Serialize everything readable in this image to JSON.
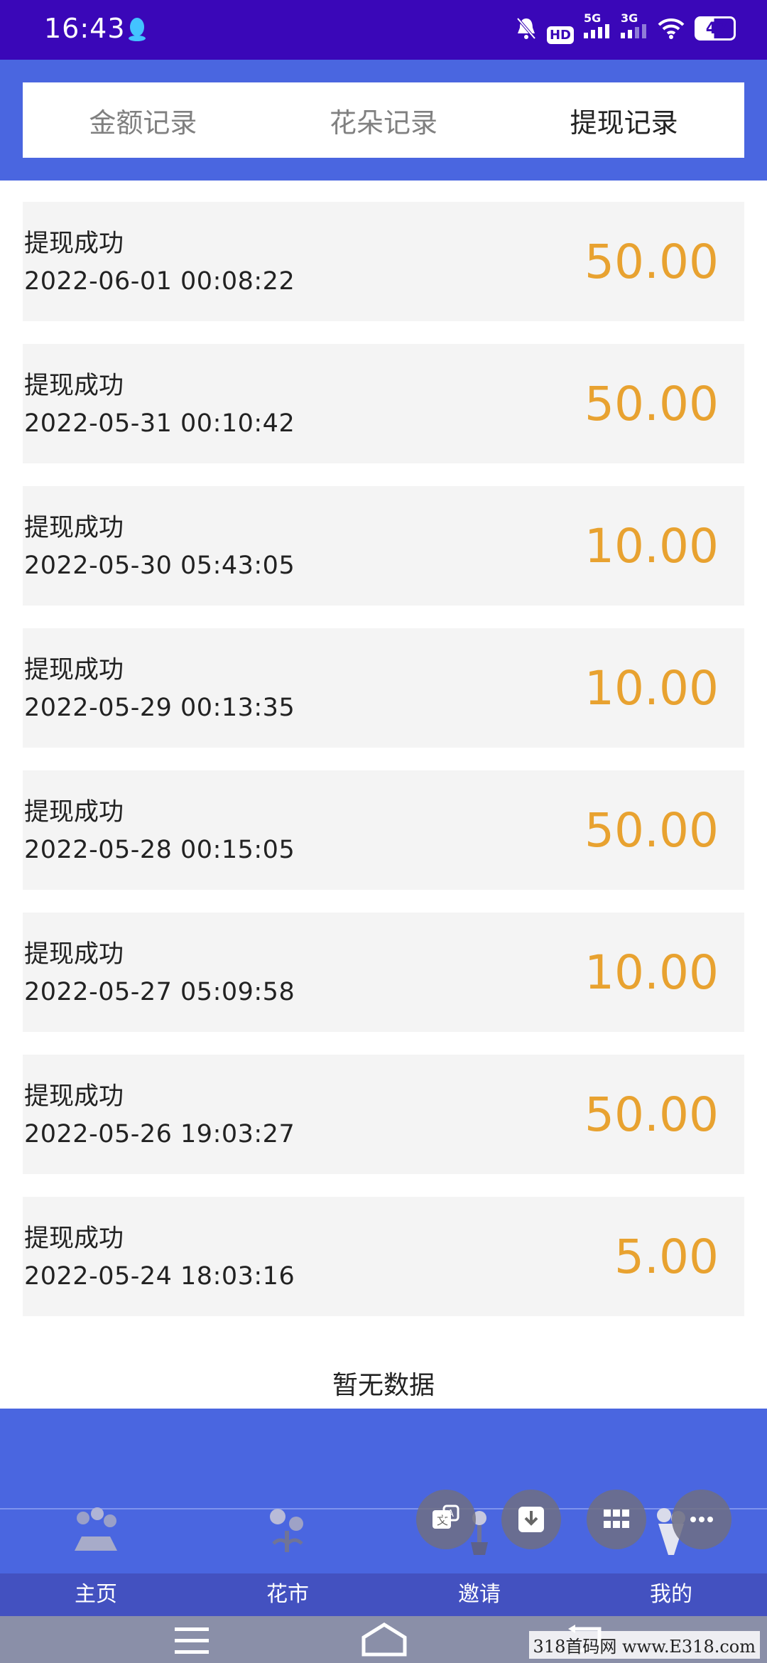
{
  "status_bar": {
    "time": "16:43",
    "network_1": "5G",
    "network_2": "3G",
    "hd": "HD",
    "battery": "47"
  },
  "tabs": [
    {
      "label": "金额记录",
      "active": false
    },
    {
      "label": "花朵记录",
      "active": false
    },
    {
      "label": "提现记录",
      "active": true
    }
  ],
  "records": [
    {
      "status": "提现成功",
      "datetime": "2022-06-01 00:08:22",
      "amount": "50.00"
    },
    {
      "status": "提现成功",
      "datetime": "2022-05-31 00:10:42",
      "amount": "50.00"
    },
    {
      "status": "提现成功",
      "datetime": "2022-05-30 05:43:05",
      "amount": "10.00"
    },
    {
      "status": "提现成功",
      "datetime": "2022-05-29 00:13:35",
      "amount": "10.00"
    },
    {
      "status": "提现成功",
      "datetime": "2022-05-28 00:15:05",
      "amount": "50.00"
    },
    {
      "status": "提现成功",
      "datetime": "2022-05-27 05:09:58",
      "amount": "10.00"
    },
    {
      "status": "提现成功",
      "datetime": "2022-05-26 19:03:27",
      "amount": "50.00"
    },
    {
      "status": "提现成功",
      "datetime": "2022-05-24 18:03:16",
      "amount": "5.00"
    }
  ],
  "empty_text": "暂无数据",
  "bottom_nav": [
    {
      "label": "主页",
      "icon": "flower-pot-icon"
    },
    {
      "label": "花市",
      "icon": "flower-market-icon"
    },
    {
      "label": "邀请",
      "icon": "invite-flower-icon"
    },
    {
      "label": "我的",
      "icon": "bouquet-icon"
    }
  ],
  "floating_buttons": [
    "translate-icon",
    "download-icon",
    "grid-icon",
    "more-icon"
  ],
  "watermark": "318首码网 www.E318.com",
  "colors": {
    "status_bar": "#3a07b8",
    "header_blue": "#4a66e0",
    "amount": "#e8a230",
    "row_bg": "#f4f4f4"
  }
}
